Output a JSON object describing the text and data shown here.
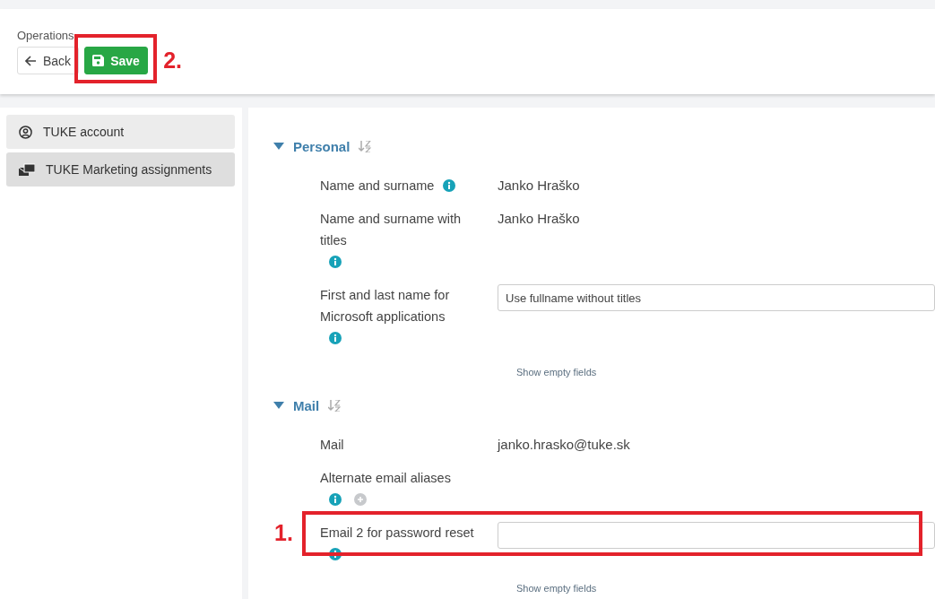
{
  "header": {
    "caption": "Operations",
    "buttons": [
      {
        "label": "Back",
        "kind": "back"
      },
      {
        "label": "Save",
        "kind": "save",
        "annotation": "2."
      }
    ]
  },
  "sidebar": {
    "items": [
      {
        "label": "TUKE account",
        "kind": "account",
        "selected": false
      },
      {
        "label": "TUKE Marketing assignments",
        "kind": "assignments",
        "selected": true
      }
    ]
  },
  "sections": [
    {
      "title": "Personal",
      "expanded": true,
      "show_empty_link": "Show empty fields",
      "fields": [
        {
          "label": "Name and surname",
          "info": true,
          "add": false,
          "kind": "text",
          "value": "Janko Hraško"
        },
        {
          "label": "Name and surname with titles",
          "info": true,
          "add": false,
          "kind": "text",
          "value": "Janko Hraško"
        },
        {
          "label": "First and last name for Microsoft applications",
          "info": true,
          "add": false,
          "kind": "select",
          "value": "Use fullname without titles"
        }
      ]
    },
    {
      "title": "Mail",
      "expanded": true,
      "show_empty_link": "Show empty fields",
      "fields": [
        {
          "label": "Mail",
          "info": false,
          "add": false,
          "kind": "text",
          "value": "janko.hrasko@tuke.sk"
        },
        {
          "label": "Alternate email aliases",
          "info": true,
          "add": true,
          "kind": "none"
        },
        {
          "label": "Email 2 for password reset",
          "info": true,
          "add": false,
          "kind": "input",
          "annotation": "1."
        }
      ]
    }
  ]
}
